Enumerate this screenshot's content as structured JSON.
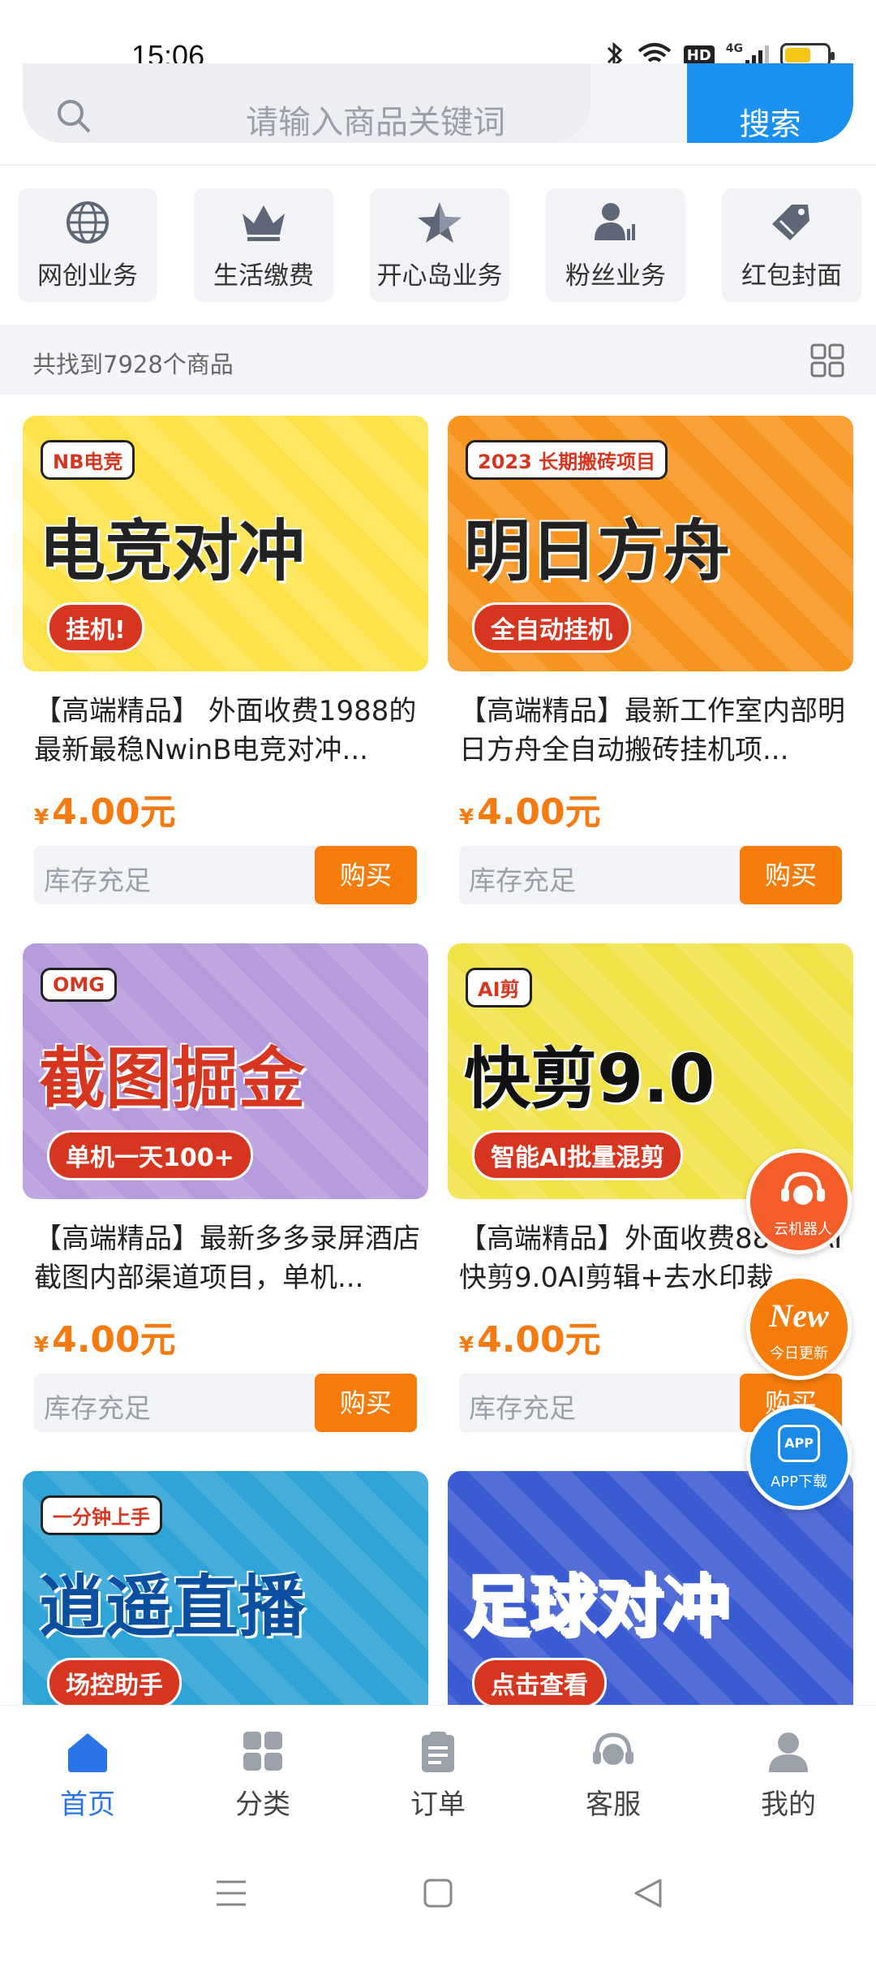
{
  "status": {
    "time": "15:06",
    "network": "4G",
    "hd": "HD"
  },
  "search": {
    "placeholder": "请输入商品关键词",
    "button": "搜索"
  },
  "categories": [
    {
      "label": "网创业务",
      "icon": "globe-icon"
    },
    {
      "label": "生活缴费",
      "icon": "crown-icon"
    },
    {
      "label": "开心岛业务",
      "icon": "star-icon"
    },
    {
      "label": "粉丝业务",
      "icon": "fans-icon"
    },
    {
      "label": "红包封面",
      "icon": "tag-icon"
    }
  ],
  "result_count": "共找到7928个商品",
  "products": [
    {
      "title": "【高端精品】 外面收费1988的最新最稳NwinB电竞对冲...",
      "price": "4.00元",
      "currency": "¥",
      "stock": "库存充足",
      "buy": "购买",
      "banner": {
        "main": "电竞对冲",
        "badge": "NB电竞",
        "sub": "挂机!",
        "bg": "#fde24a",
        "fg": "#222"
      }
    },
    {
      "title": "【高端精品】最新工作室内部明日方舟全自动搬砖挂机项...",
      "price": "4.00元",
      "currency": "¥",
      "stock": "库存充足",
      "buy": "购买",
      "banner": {
        "main": "明日方舟",
        "badge": "2023 长期搬砖项目",
        "sub": "全自动挂机",
        "bg": "#f7941d",
        "fg": "#222"
      }
    },
    {
      "title": "【高端精品】最新多多录屏酒店截图内部渠道项目，单机...",
      "price": "4.00元",
      "currency": "¥",
      "stock": "库存充足",
      "buy": "购买",
      "banner": {
        "main": "截图掘金",
        "badge": "OMG",
        "sub": "单机一天100+",
        "bg": "#b69bdc",
        "fg": "#d6361f"
      }
    },
    {
      "title": "【高端精品】外面收费888的AI快剪9.0AI剪辑+去水印裁...",
      "price": "4.00元",
      "currency": "¥",
      "stock": "库存充足",
      "buy": "购买",
      "banner": {
        "main": "快剪9.0",
        "badge": "AI剪",
        "sub": "智能AI批量混剪",
        "bg": "#f2e24a",
        "fg": "#111"
      }
    },
    {
      "banner": {
        "main": "逍遥直播",
        "badge": "一分钟上手",
        "sub": "场控助手",
        "bg": "#2ea3d6",
        "fg": "#0a4fa0"
      }
    },
    {
      "banner": {
        "main": "足球对冲",
        "badge": "",
        "sub": "点击查看",
        "bg": "#3b5bd2",
        "fg": "#fff"
      }
    }
  ],
  "floating": [
    {
      "label": "云机器人",
      "icon": "robot-icon",
      "color": "#f25d2a"
    },
    {
      "label": "今日更新",
      "icon": "new-icon",
      "color": "#f57c0b",
      "mark": "New"
    },
    {
      "label": "APP下载",
      "icon": "app-download-icon",
      "color": "#1a8ae6",
      "mark": "APP"
    }
  ],
  "tabs": [
    {
      "label": "首页",
      "icon": "home-icon",
      "active": true
    },
    {
      "label": "分类",
      "icon": "category-icon"
    },
    {
      "label": "订单",
      "icon": "order-icon"
    },
    {
      "label": "客服",
      "icon": "service-icon"
    },
    {
      "label": "我的",
      "icon": "profile-icon"
    }
  ],
  "colors": {
    "accent": "#2a74e8",
    "price": "#f47a12",
    "buy": "#f57c0b",
    "search_button": "#1a90f0"
  }
}
